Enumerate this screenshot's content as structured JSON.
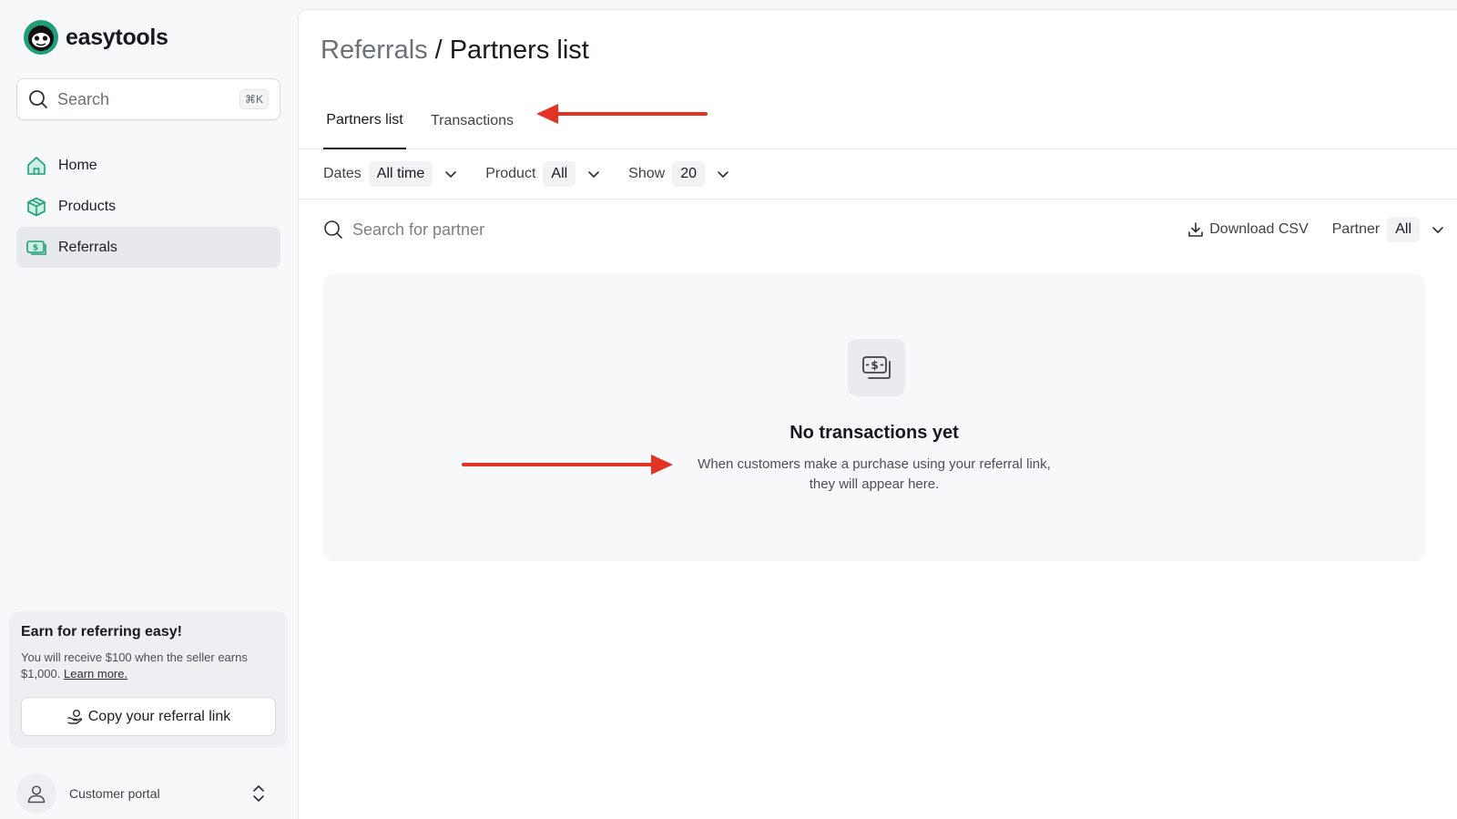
{
  "brand": {
    "name": "easytools"
  },
  "search": {
    "placeholder": "Search",
    "shortcut": "⌘K"
  },
  "sidebar": {
    "items": [
      {
        "label": "Home",
        "icon": "home-icon"
      },
      {
        "label": "Products",
        "icon": "box-icon"
      },
      {
        "label": "Referrals",
        "icon": "money-icon",
        "active": true
      }
    ]
  },
  "promo": {
    "title": "Earn for referring easy!",
    "text": "You will receive $100 when the seller earns $1,000.",
    "link": "Learn more.",
    "button": "Copy your referral link"
  },
  "portal": {
    "label": "Customer portal"
  },
  "breadcrumb": {
    "parent": "Referrals",
    "separator": "/",
    "current": "Partners list"
  },
  "tabs": [
    {
      "label": "Partners list",
      "active": true
    },
    {
      "label": "Transactions",
      "active": false
    }
  ],
  "filters": {
    "dates": {
      "label": "Dates",
      "value": "All time"
    },
    "product": {
      "label": "Product",
      "value": "All"
    },
    "show": {
      "label": "Show",
      "value": "20"
    }
  },
  "toolbar": {
    "search_placeholder": "Search for partner",
    "download": "Download CSV",
    "partner": {
      "label": "Partner",
      "value": "All"
    }
  },
  "empty_state": {
    "title": "No transactions yet",
    "line1": "When customers make a purchase using your referral link,",
    "line2": "they will appear here."
  },
  "colors": {
    "accent": "#1f9e7a",
    "annotation_arrow": "#e33325",
    "active_nav": "#e8e9ec"
  }
}
